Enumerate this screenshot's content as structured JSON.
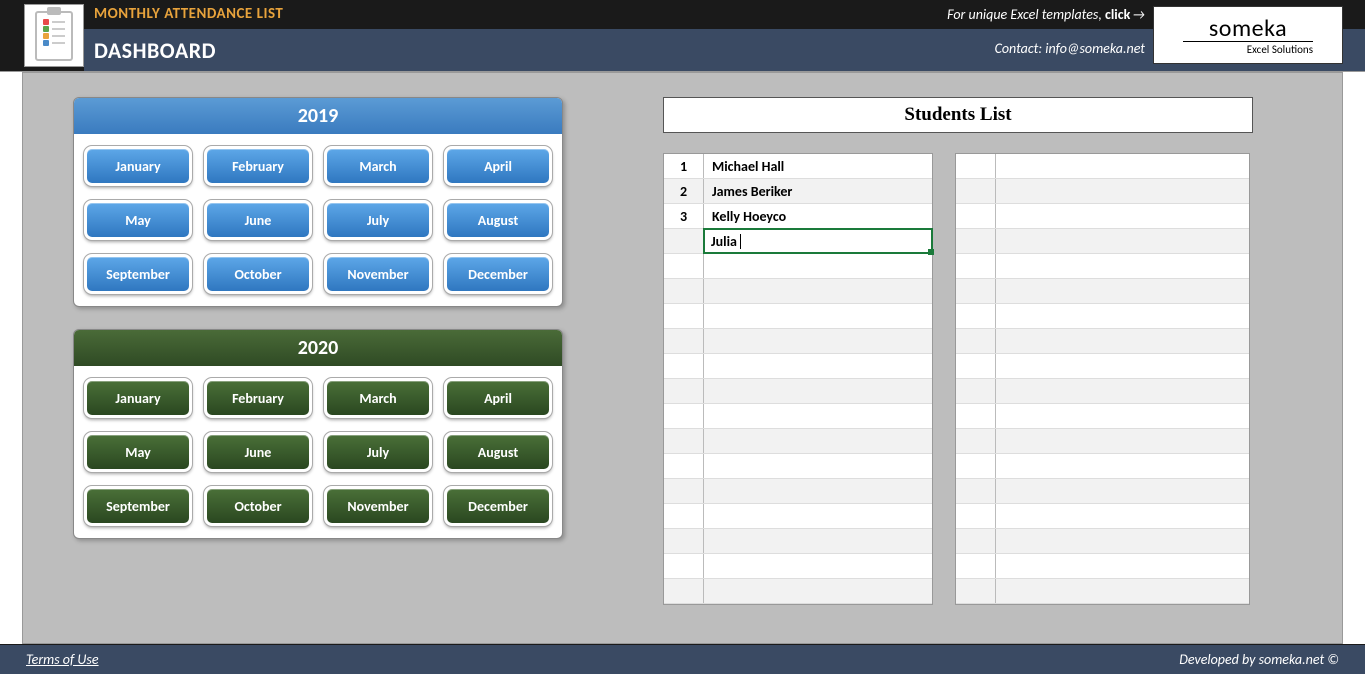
{
  "header": {
    "top_title": "MONTHLY ATTENDANCE LIST",
    "bottom_title": "DASHBOARD",
    "promo_prefix": "For unique Excel templates, ",
    "promo_bold": "click",
    "contact_label": "Contact: info@someka.net",
    "brand_name": "someka",
    "brand_sub": "Excel Solutions"
  },
  "years": [
    {
      "label": "2019",
      "theme": "blue",
      "months": [
        "January",
        "February",
        "March",
        "April",
        "May",
        "June",
        "July",
        "August",
        "September",
        "October",
        "November",
        "December"
      ]
    },
    {
      "label": "2020",
      "theme": "green",
      "months": [
        "January",
        "February",
        "March",
        "April",
        "May",
        "June",
        "July",
        "August",
        "September",
        "October",
        "November",
        "December"
      ]
    }
  ],
  "students_title": "Students List",
  "students_left": [
    {
      "n": "1",
      "name": "Michael Hall"
    },
    {
      "n": "2",
      "name": "James Beriker"
    },
    {
      "n": "3",
      "name": "Kelly Hoeyco"
    }
  ],
  "editing_value": "Julia",
  "left_blank_rows": 14,
  "right_blank_rows": 18,
  "footer": {
    "left": "Terms of Use",
    "right": "Developed by someka.net ©"
  }
}
